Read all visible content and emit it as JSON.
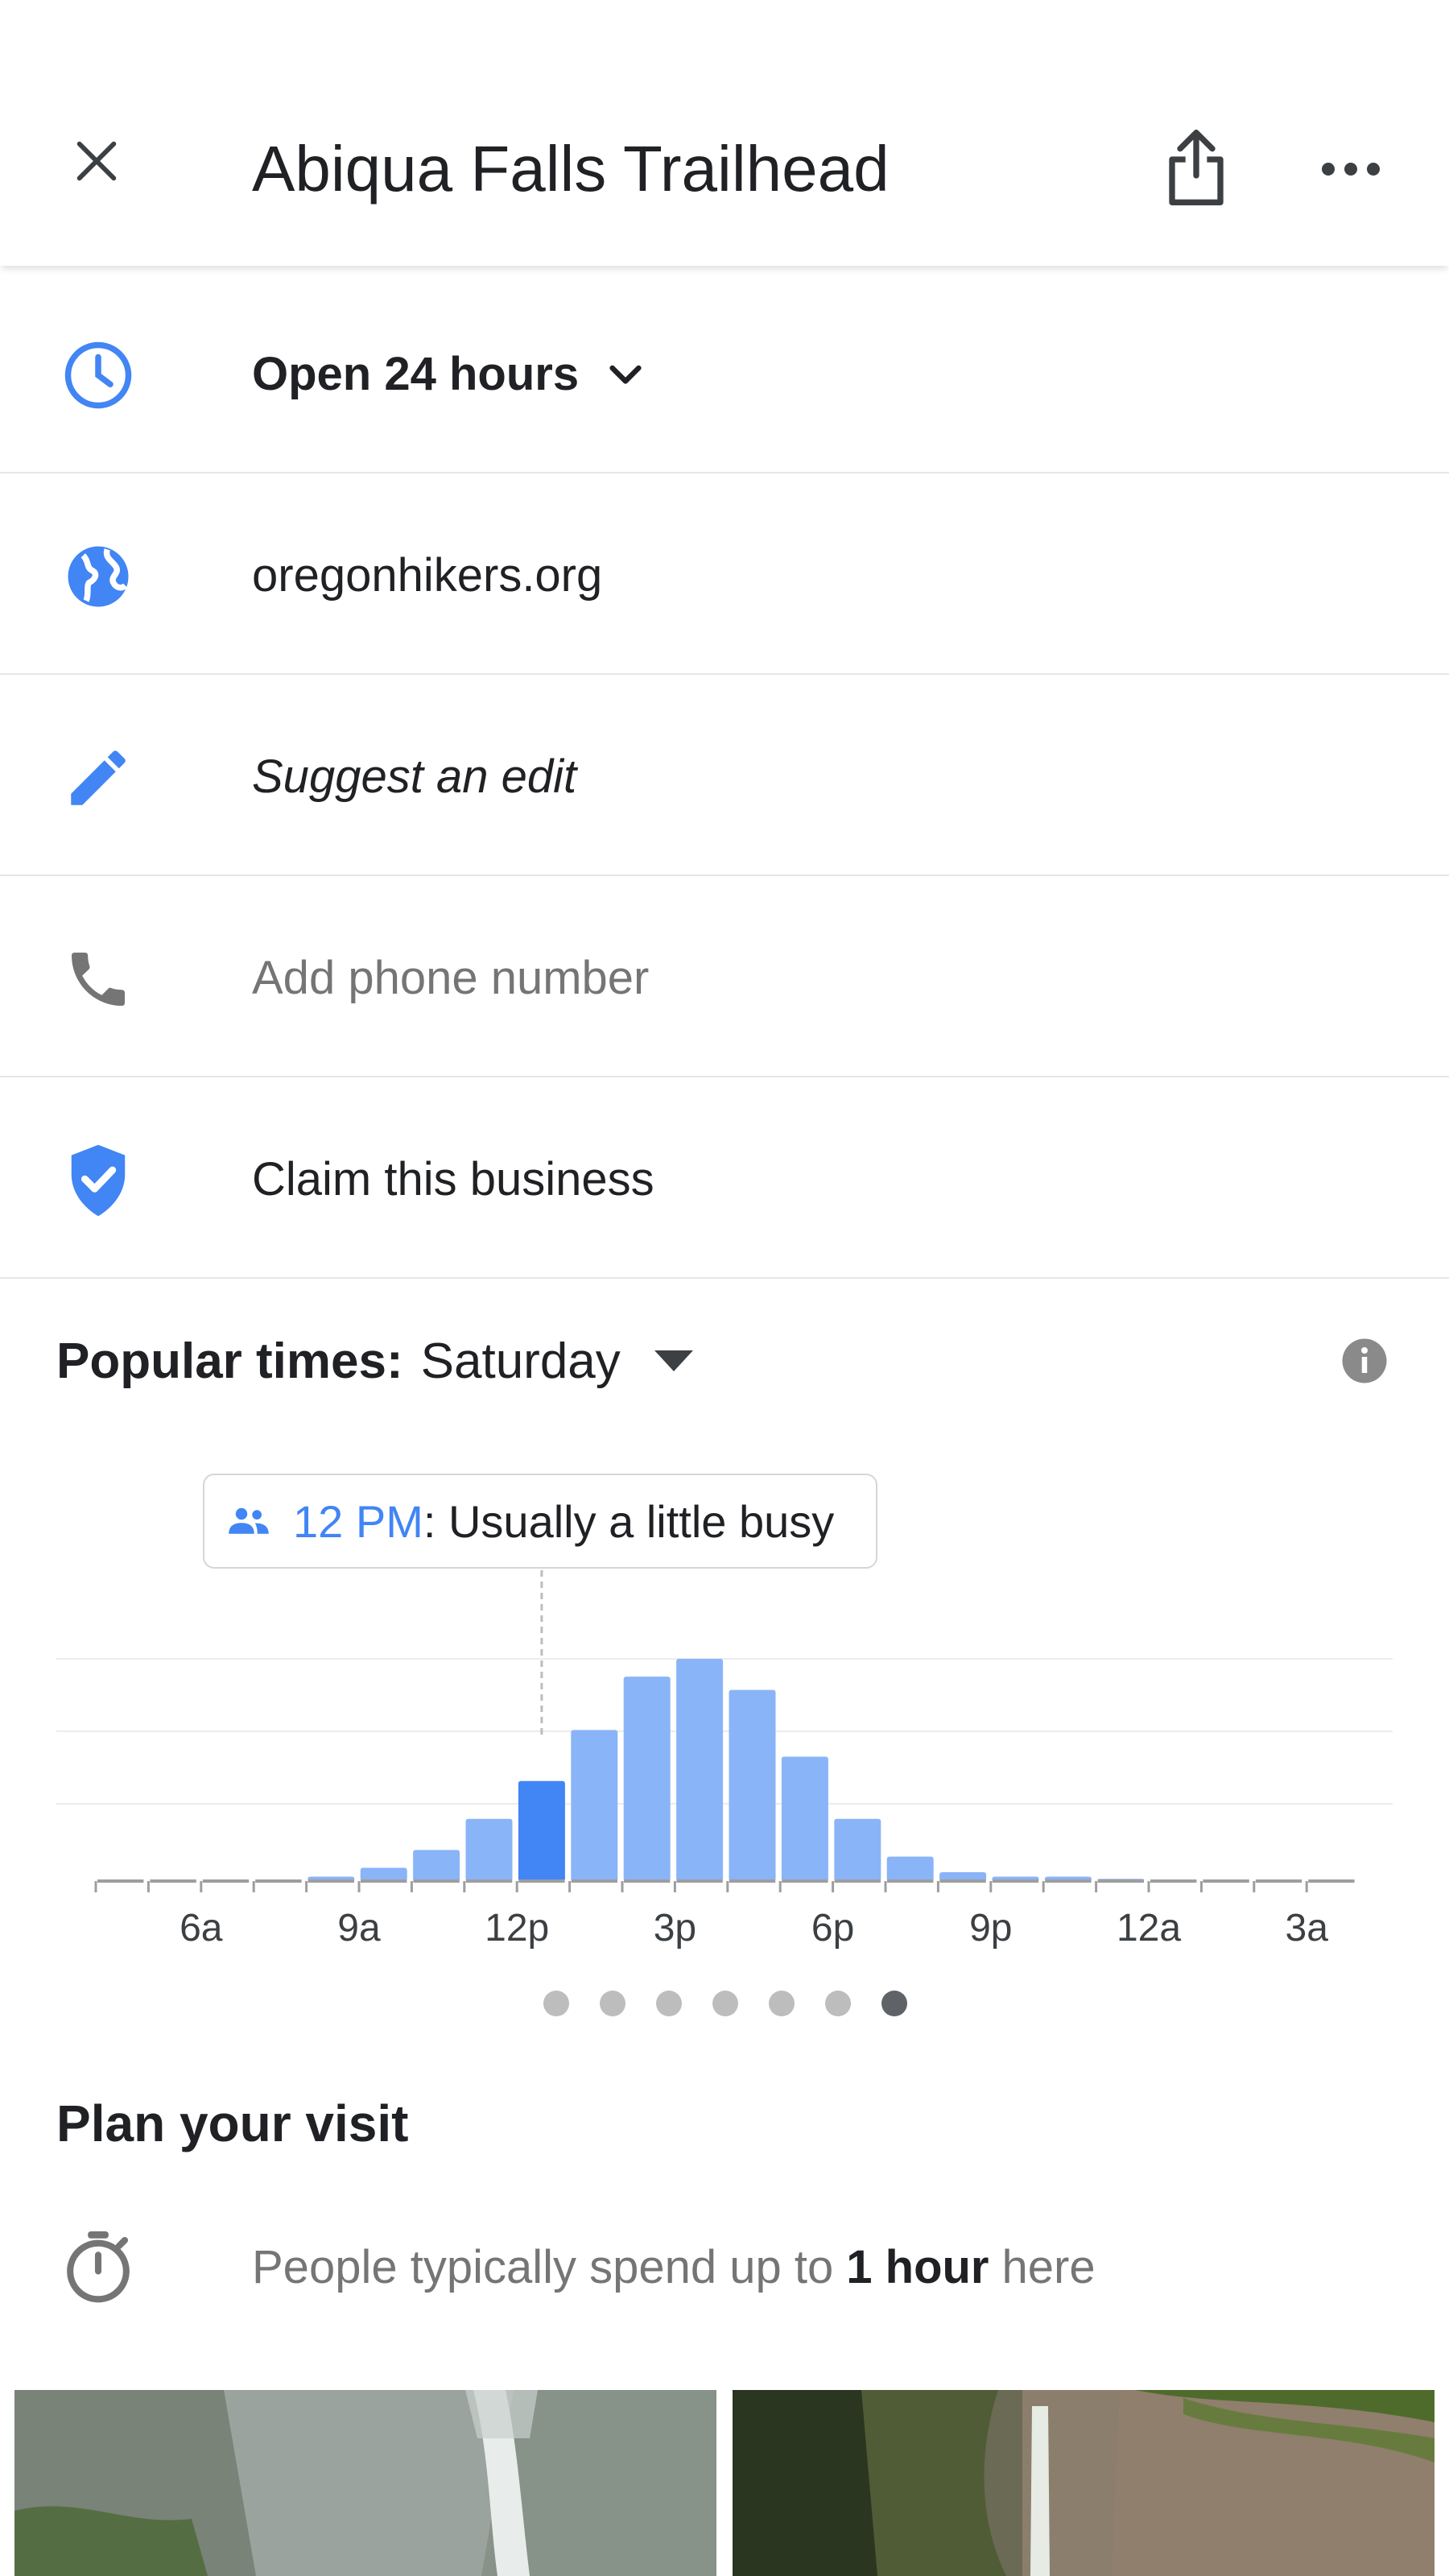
{
  "header": {
    "title": "Abiqua Falls Trailhead"
  },
  "info_rows": {
    "hours": "Open 24 hours",
    "website": "oregonhikers.org",
    "suggest_edit": "Suggest an edit",
    "phone": "Add phone number",
    "claim": "Claim this business"
  },
  "popular_times": {
    "label": "Popular times:",
    "day": "Saturday",
    "tooltip_time": "12 PM",
    "tooltip_text": ": Usually a little busy"
  },
  "chart_data": {
    "type": "bar",
    "title": "Popular times: Saturday",
    "x_tick_labels": [
      "6a",
      "9a",
      "12p",
      "3p",
      "6p",
      "9p",
      "12a",
      "3a"
    ],
    "categories": [
      "4a",
      "5a",
      "6a",
      "7a",
      "8a",
      "9a",
      "10a",
      "11a",
      "12p",
      "1p",
      "2p",
      "3p",
      "4p",
      "5p",
      "6p",
      "7p",
      "8p",
      "9p",
      "10p",
      "11p",
      "12a",
      "1a",
      "2a",
      "3a"
    ],
    "values": [
      0,
      0,
      0,
      0,
      2,
      6,
      14,
      28,
      45,
      68,
      92,
      100,
      86,
      56,
      28,
      11,
      4,
      2,
      2,
      1,
      0,
      0,
      0,
      0
    ],
    "highlighted_category": "12p",
    "color": "#8ab4f8",
    "highlight_color": "#4285f4"
  },
  "pager": {
    "count": 7,
    "active_index": 6
  },
  "plan": {
    "title": "Plan your visit",
    "duration_prefix": "People typically spend up to",
    "duration_value": "1 hour",
    "duration_suffix": "here"
  },
  "colors": {
    "accent": "#4285f4",
    "icon_gray": "#5f6368"
  }
}
